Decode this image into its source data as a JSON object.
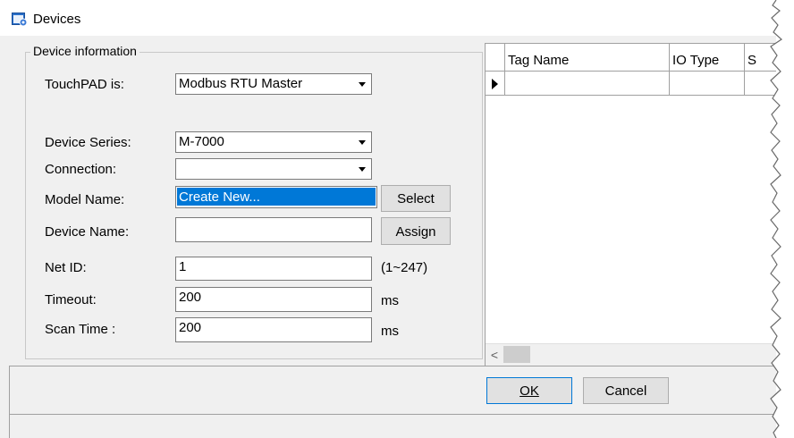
{
  "window": {
    "title": "Devices",
    "icon": "devices-app-icon"
  },
  "group": {
    "title": "Device information"
  },
  "form": {
    "touchpad_label": "TouchPAD is:",
    "touchpad_value": "Modbus RTU Master",
    "series_label": "Device Series:",
    "series_value": "M-7000",
    "connection_label": "Connection:",
    "connection_value": "",
    "model_label": "Model Name:",
    "model_value": "Create New...",
    "device_name_label": "Device Name:",
    "device_name_value": "",
    "netid_label": "Net ID:",
    "netid_value": "1",
    "netid_range": "(1~247)",
    "timeout_label": "Timeout:",
    "timeout_value": "200",
    "timeout_unit": "ms",
    "scantime_label": "Scan Time :",
    "scantime_value": "200",
    "scantime_unit": "ms"
  },
  "buttons": {
    "select": "Select",
    "assign": "Assign",
    "ok": "OK",
    "cancel": "Cancel"
  },
  "grid": {
    "columns": [
      "Tag Name",
      "IO Type",
      "S"
    ],
    "scroll_left": "<"
  },
  "colors": {
    "selection": "#0078d7",
    "background": "#f0f0f0"
  }
}
